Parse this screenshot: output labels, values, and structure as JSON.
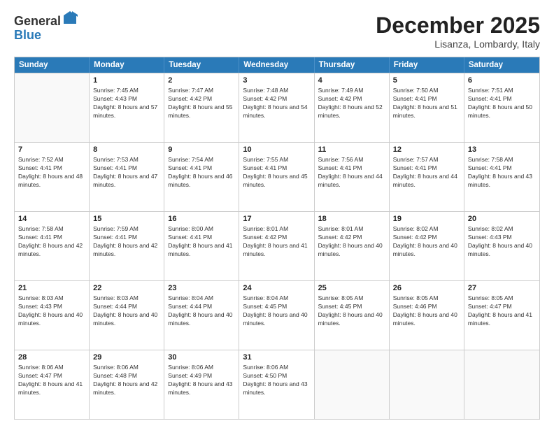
{
  "logo": {
    "general": "General",
    "blue": "Blue"
  },
  "header": {
    "month": "December 2025",
    "location": "Lisanza, Lombardy, Italy"
  },
  "weekdays": [
    "Sunday",
    "Monday",
    "Tuesday",
    "Wednesday",
    "Thursday",
    "Friday",
    "Saturday"
  ],
  "rows": [
    [
      {
        "day": "",
        "sunrise": "",
        "sunset": "",
        "daylight": ""
      },
      {
        "day": "1",
        "sunrise": "Sunrise: 7:45 AM",
        "sunset": "Sunset: 4:43 PM",
        "daylight": "Daylight: 8 hours and 57 minutes."
      },
      {
        "day": "2",
        "sunrise": "Sunrise: 7:47 AM",
        "sunset": "Sunset: 4:42 PM",
        "daylight": "Daylight: 8 hours and 55 minutes."
      },
      {
        "day": "3",
        "sunrise": "Sunrise: 7:48 AM",
        "sunset": "Sunset: 4:42 PM",
        "daylight": "Daylight: 8 hours and 54 minutes."
      },
      {
        "day": "4",
        "sunrise": "Sunrise: 7:49 AM",
        "sunset": "Sunset: 4:42 PM",
        "daylight": "Daylight: 8 hours and 52 minutes."
      },
      {
        "day": "5",
        "sunrise": "Sunrise: 7:50 AM",
        "sunset": "Sunset: 4:41 PM",
        "daylight": "Daylight: 8 hours and 51 minutes."
      },
      {
        "day": "6",
        "sunrise": "Sunrise: 7:51 AM",
        "sunset": "Sunset: 4:41 PM",
        "daylight": "Daylight: 8 hours and 50 minutes."
      }
    ],
    [
      {
        "day": "7",
        "sunrise": "Sunrise: 7:52 AM",
        "sunset": "Sunset: 4:41 PM",
        "daylight": "Daylight: 8 hours and 48 minutes."
      },
      {
        "day": "8",
        "sunrise": "Sunrise: 7:53 AM",
        "sunset": "Sunset: 4:41 PM",
        "daylight": "Daylight: 8 hours and 47 minutes."
      },
      {
        "day": "9",
        "sunrise": "Sunrise: 7:54 AM",
        "sunset": "Sunset: 4:41 PM",
        "daylight": "Daylight: 8 hours and 46 minutes."
      },
      {
        "day": "10",
        "sunrise": "Sunrise: 7:55 AM",
        "sunset": "Sunset: 4:41 PM",
        "daylight": "Daylight: 8 hours and 45 minutes."
      },
      {
        "day": "11",
        "sunrise": "Sunrise: 7:56 AM",
        "sunset": "Sunset: 4:41 PM",
        "daylight": "Daylight: 8 hours and 44 minutes."
      },
      {
        "day": "12",
        "sunrise": "Sunrise: 7:57 AM",
        "sunset": "Sunset: 4:41 PM",
        "daylight": "Daylight: 8 hours and 44 minutes."
      },
      {
        "day": "13",
        "sunrise": "Sunrise: 7:58 AM",
        "sunset": "Sunset: 4:41 PM",
        "daylight": "Daylight: 8 hours and 43 minutes."
      }
    ],
    [
      {
        "day": "14",
        "sunrise": "Sunrise: 7:58 AM",
        "sunset": "Sunset: 4:41 PM",
        "daylight": "Daylight: 8 hours and 42 minutes."
      },
      {
        "day": "15",
        "sunrise": "Sunrise: 7:59 AM",
        "sunset": "Sunset: 4:41 PM",
        "daylight": "Daylight: 8 hours and 42 minutes."
      },
      {
        "day": "16",
        "sunrise": "Sunrise: 8:00 AM",
        "sunset": "Sunset: 4:41 PM",
        "daylight": "Daylight: 8 hours and 41 minutes."
      },
      {
        "day": "17",
        "sunrise": "Sunrise: 8:01 AM",
        "sunset": "Sunset: 4:42 PM",
        "daylight": "Daylight: 8 hours and 41 minutes."
      },
      {
        "day": "18",
        "sunrise": "Sunrise: 8:01 AM",
        "sunset": "Sunset: 4:42 PM",
        "daylight": "Daylight: 8 hours and 40 minutes."
      },
      {
        "day": "19",
        "sunrise": "Sunrise: 8:02 AM",
        "sunset": "Sunset: 4:42 PM",
        "daylight": "Daylight: 8 hours and 40 minutes."
      },
      {
        "day": "20",
        "sunrise": "Sunrise: 8:02 AM",
        "sunset": "Sunset: 4:43 PM",
        "daylight": "Daylight: 8 hours and 40 minutes."
      }
    ],
    [
      {
        "day": "21",
        "sunrise": "Sunrise: 8:03 AM",
        "sunset": "Sunset: 4:43 PM",
        "daylight": "Daylight: 8 hours and 40 minutes."
      },
      {
        "day": "22",
        "sunrise": "Sunrise: 8:03 AM",
        "sunset": "Sunset: 4:44 PM",
        "daylight": "Daylight: 8 hours and 40 minutes."
      },
      {
        "day": "23",
        "sunrise": "Sunrise: 8:04 AM",
        "sunset": "Sunset: 4:44 PM",
        "daylight": "Daylight: 8 hours and 40 minutes."
      },
      {
        "day": "24",
        "sunrise": "Sunrise: 8:04 AM",
        "sunset": "Sunset: 4:45 PM",
        "daylight": "Daylight: 8 hours and 40 minutes."
      },
      {
        "day": "25",
        "sunrise": "Sunrise: 8:05 AM",
        "sunset": "Sunset: 4:45 PM",
        "daylight": "Daylight: 8 hours and 40 minutes."
      },
      {
        "day": "26",
        "sunrise": "Sunrise: 8:05 AM",
        "sunset": "Sunset: 4:46 PM",
        "daylight": "Daylight: 8 hours and 40 minutes."
      },
      {
        "day": "27",
        "sunrise": "Sunrise: 8:05 AM",
        "sunset": "Sunset: 4:47 PM",
        "daylight": "Daylight: 8 hours and 41 minutes."
      }
    ],
    [
      {
        "day": "28",
        "sunrise": "Sunrise: 8:06 AM",
        "sunset": "Sunset: 4:47 PM",
        "daylight": "Daylight: 8 hours and 41 minutes."
      },
      {
        "day": "29",
        "sunrise": "Sunrise: 8:06 AM",
        "sunset": "Sunset: 4:48 PM",
        "daylight": "Daylight: 8 hours and 42 minutes."
      },
      {
        "day": "30",
        "sunrise": "Sunrise: 8:06 AM",
        "sunset": "Sunset: 4:49 PM",
        "daylight": "Daylight: 8 hours and 43 minutes."
      },
      {
        "day": "31",
        "sunrise": "Sunrise: 8:06 AM",
        "sunset": "Sunset: 4:50 PM",
        "daylight": "Daylight: 8 hours and 43 minutes."
      },
      {
        "day": "",
        "sunrise": "",
        "sunset": "",
        "daylight": ""
      },
      {
        "day": "",
        "sunrise": "",
        "sunset": "",
        "daylight": ""
      },
      {
        "day": "",
        "sunrise": "",
        "sunset": "",
        "daylight": ""
      }
    ]
  ]
}
